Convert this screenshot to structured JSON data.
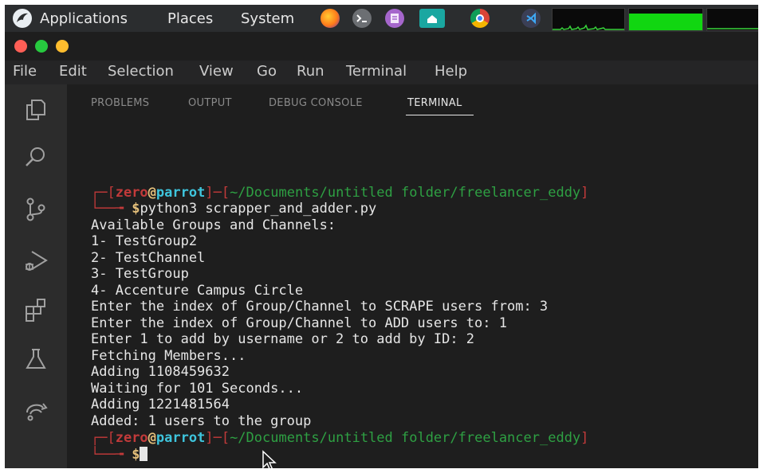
{
  "system_panel": {
    "menus": [
      "Applications",
      "Places",
      "System"
    ],
    "launchers": [
      "firefox-icon",
      "terminal-icon",
      "text-editor-icon",
      "file-manager-icon",
      "chrome-icon",
      "vscode-icon"
    ]
  },
  "window": {
    "controls": [
      "close-button",
      "maximize-button",
      "minimize-button"
    ]
  },
  "menubar": {
    "items": [
      "File",
      "Edit",
      "Selection",
      "View",
      "Go",
      "Run",
      "Terminal",
      "Help"
    ]
  },
  "activity_bar": {
    "icons": [
      "explorer-icon",
      "search-icon",
      "source-control-icon",
      "run-debug-icon",
      "extensions-icon",
      "testing-icon",
      "remote-icon"
    ]
  },
  "panel": {
    "tabs": [
      "PROBLEMS",
      "OUTPUT",
      "DEBUG CONSOLE",
      "TERMINAL"
    ],
    "active_tab": "TERMINAL"
  },
  "terminal": {
    "prompt": {
      "user": "zero",
      "at": "@",
      "host": "parrot",
      "path": "~/Documents/untitled folder/freelancer_eddy",
      "symbol": "$"
    },
    "command": "python3 scrapper_and_adder.py",
    "output": [
      "Available Groups and Channels:",
      "1- TestGroup2",
      "2- TestChannel",
      "3- TestGroup",
      "4- Accenture Campus Circle",
      "Enter the index of Group/Channel to SCRAPE users from: 3",
      "Enter the index of Group/Channel to ADD users to: 1",
      "Enter 1 to add by username or 2 to add by ID: 2",
      "Fetching Members...",
      "Adding 1108459632",
      "Waiting for 101 Seconds...",
      "Adding 1221481564",
      "Added: 1 users to the group"
    ]
  },
  "colors": {
    "prompt_frame": "#c23a3a",
    "path": "#2ea043",
    "host": "#3ec4dc",
    "symbol": "#e5c07b",
    "accent_active_tab": "#e7e7e7"
  }
}
